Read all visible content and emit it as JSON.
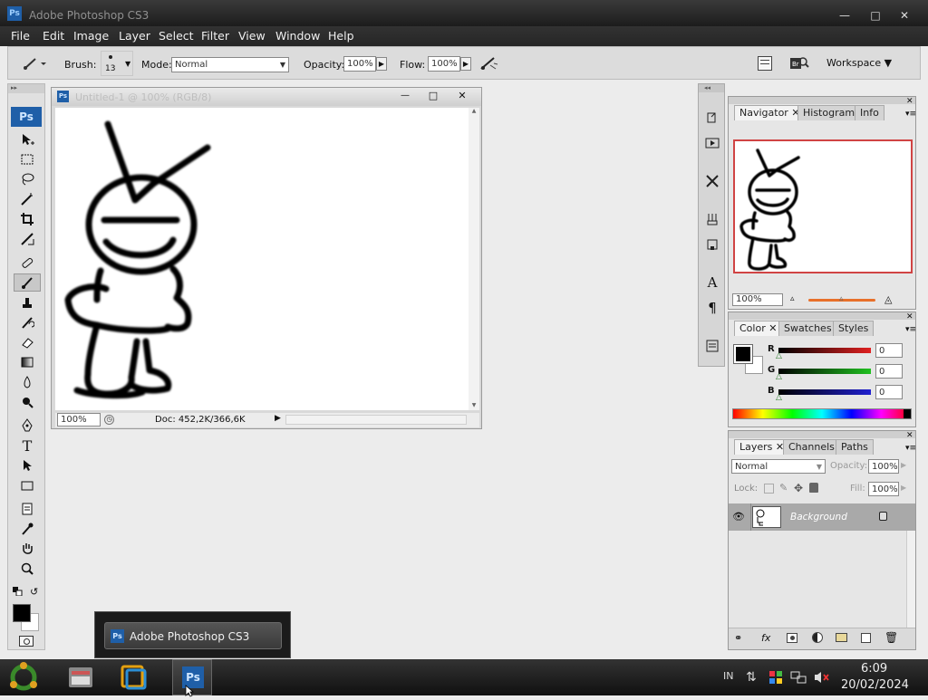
{
  "app": {
    "title": "Adobe Photoshop CS3",
    "logo": "Ps"
  },
  "window_controls": {
    "minimize": "—",
    "maximize": "□",
    "close": "✕"
  },
  "menu": [
    "File",
    "Edit",
    "Image",
    "Layer",
    "Select",
    "Filter",
    "View",
    "Window",
    "Help"
  ],
  "options": {
    "brush_label": "Brush:",
    "brush_size": "13",
    "mode_label": "Mode:",
    "mode_value": "Normal",
    "opacity_label": "Opacity:",
    "opacity_value": "100%",
    "flow_label": "Flow:",
    "flow_value": "100%",
    "workspace_label": "Workspace ▼"
  },
  "document": {
    "title": "Untitled-1 @ 100% (RGB/8)",
    "zoom": "100%",
    "doc_size": "Doc: 452,2K/366,6K"
  },
  "navigator": {
    "tabs": [
      "Navigator",
      "Histogram",
      "Info"
    ],
    "zoom": "100%"
  },
  "color_panel": {
    "tabs": [
      "Color",
      "Swatches",
      "Styles"
    ],
    "r_label": "R",
    "g_label": "G",
    "b_label": "B",
    "r_value": "0",
    "g_value": "0",
    "b_value": "0",
    "r_color": "#e02020",
    "g_color": "#20c020",
    "b_color": "#2020d0"
  },
  "layers_panel": {
    "tabs": [
      "Layers",
      "Channels",
      "Paths"
    ],
    "blend_mode": "Normal",
    "opacity_label": "Opacity:",
    "opacity_value": "100%",
    "lock_label": "Lock:",
    "fill_label": "Fill:",
    "fill_value": "100%",
    "layer_name": "Background"
  },
  "taskbar": {
    "popup_label": "Adobe Photoshop CS3",
    "lang": "IN",
    "time": "6:09",
    "date": "20/02/2024"
  }
}
